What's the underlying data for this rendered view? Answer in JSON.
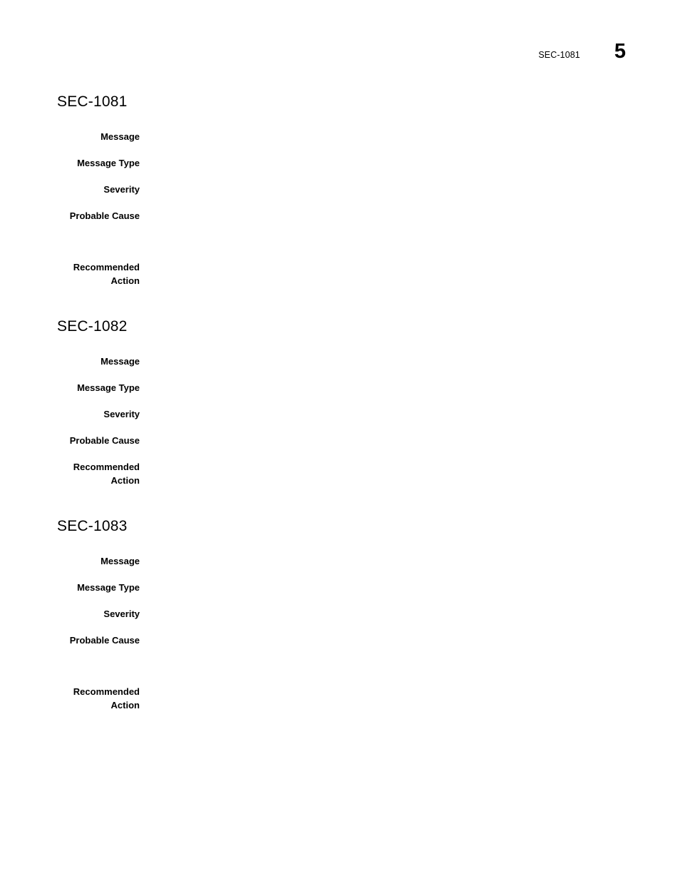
{
  "header": {
    "running_title": "SEC-1081",
    "page_number": "5"
  },
  "sections": [
    {
      "heading": "SEC-1081",
      "fields": [
        {
          "label": "Message",
          "value": "",
          "gap": "gap-first"
        },
        {
          "label": "Message Type",
          "value": "",
          "gap": "gap-std"
        },
        {
          "label": "Severity",
          "value": "",
          "gap": "gap-std"
        },
        {
          "label": "Probable Cause",
          "value": "",
          "gap": "gap-std"
        },
        {
          "label": "Recommended Action",
          "value": "",
          "gap": "gap-xwide"
        }
      ]
    },
    {
      "heading": "SEC-1082",
      "fields": [
        {
          "label": "Message",
          "value": "",
          "gap": "gap-first"
        },
        {
          "label": "Message Type",
          "value": "",
          "gap": "gap-std"
        },
        {
          "label": "Severity",
          "value": "",
          "gap": "gap-std"
        },
        {
          "label": "Probable Cause",
          "value": "",
          "gap": "gap-std"
        },
        {
          "label": "Recommended Action",
          "value": "",
          "gap": "gap-std"
        }
      ]
    },
    {
      "heading": "SEC-1083",
      "fields": [
        {
          "label": "Message",
          "value": "",
          "gap": "gap-first"
        },
        {
          "label": "Message Type",
          "value": "",
          "gap": "gap-std"
        },
        {
          "label": "Severity",
          "value": "",
          "gap": "gap-std"
        },
        {
          "label": "Probable Cause",
          "value": "",
          "gap": "gap-std"
        },
        {
          "label": "Recommended Action",
          "value": "",
          "gap": "gap-xwide"
        }
      ]
    }
  ]
}
